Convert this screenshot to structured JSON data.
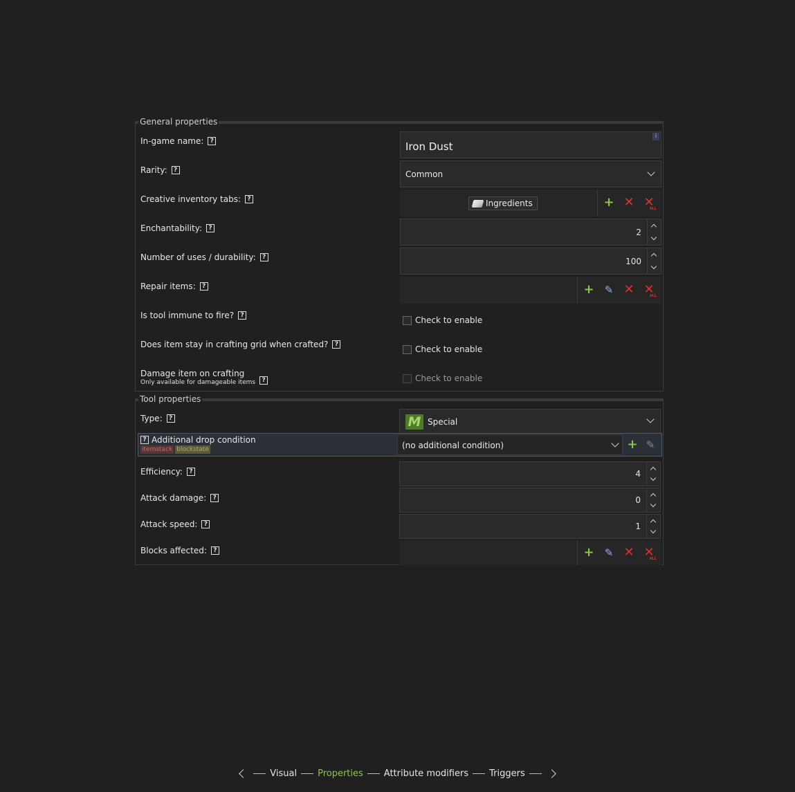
{
  "general": {
    "title": "General properties",
    "name_label": "In-game name:",
    "name_value": "Iron Dust",
    "info_badge": "i",
    "rarity_label": "Rarity:",
    "rarity_value": "Common",
    "tabs_label": "Creative inventory tabs:",
    "tab_chip": "Ingredients",
    "enchant_label": "Enchantability:",
    "enchant_value": "2",
    "uses_label": "Number of uses / durability:",
    "uses_value": "100",
    "repair_label": "Repair items:",
    "fire_label": "Is tool immune to fire?",
    "stay_label": "Does item stay in crafting grid when crafted?",
    "damage_label": "Damage item on crafting",
    "damage_sublabel": "Only available for damageable items",
    "check_text": "Check to enable"
  },
  "tool": {
    "title": "Tool properties",
    "type_label": "Type:",
    "type_value": "Special",
    "type_icon": "M",
    "drop_label": "Additional drop condition",
    "tag_itemstack": "itemstack",
    "tag_blockstate": "blockstate",
    "drop_value": "(no additional condition)",
    "efficiency_label": "Efficiency:",
    "efficiency_value": "4",
    "attack_damage_label": "Attack damage:",
    "attack_damage_value": "0",
    "attack_speed_label": "Attack speed:",
    "attack_speed_value": "1",
    "blocks_label": "Blocks affected:"
  },
  "help_glyph": "?",
  "icons": {
    "plus": "+",
    "cross": "✕",
    "edit": "✎"
  },
  "nav": {
    "visual": "Visual",
    "properties": "Properties",
    "attribute_modifiers": "Attribute modifiers",
    "triggers": "Triggers"
  },
  "colors": {
    "accent": "#8dc63f",
    "danger": "#e0302a",
    "background": "#202020"
  }
}
